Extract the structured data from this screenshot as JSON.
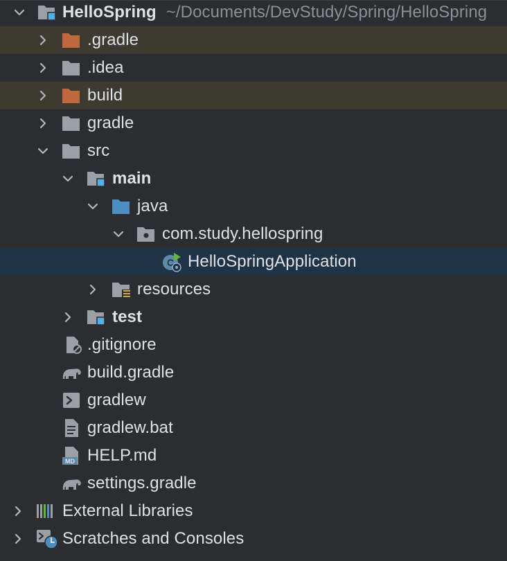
{
  "project": {
    "name": "HelloSpring",
    "path": "~/Documents/DevStudy/Spring/HelloSpring"
  },
  "items": {
    "gradle_dir": ".gradle",
    "idea_dir": ".idea",
    "build_dir": "build",
    "gradle_folder": "gradle",
    "src": "src",
    "main": "main",
    "java": "java",
    "package": "com.study.hellospring",
    "app_class": "HelloSpringApplication",
    "resources": "resources",
    "test": "test",
    "gitignore": ".gitignore",
    "build_gradle": "build.gradle",
    "gradlew": "gradlew",
    "gradlew_bat": "gradlew.bat",
    "help_md": "HELP.md",
    "settings_gradle": "settings.gradle",
    "external_libraries": "External Libraries",
    "scratches": "Scratches and Consoles"
  },
  "icons": {
    "chevron_right": "chevron-right-icon",
    "chevron_down": "chevron-down-icon",
    "folder": "folder-icon",
    "excluded_folder": "excluded-folder-icon",
    "module_folder": "module-folder-icon",
    "source_folder": "source-folder-icon",
    "package": "package-icon",
    "spring_class": "spring-boot-class-icon",
    "resources_folder": "resources-folder-icon",
    "gitignore_file": "gitignore-file-icon",
    "gradle_file": "gradle-elephant-icon",
    "shell_script": "shell-script-icon",
    "text_file": "text-file-icon",
    "markdown_file": "markdown-file-icon",
    "libraries": "libraries-icon",
    "scratches": "scratches-icon"
  },
  "colors": {
    "background": "#2b2d30",
    "excluded_row": "#3d3a32",
    "selected_row": "#1f3346",
    "text": "#dfe1e5",
    "muted_path": "#8c8f95",
    "folder_gray": "#9aa0a6",
    "folder_excluded": "#c0683d",
    "folder_source": "#4c8ec1",
    "module_marker": "#4fb2e6"
  }
}
